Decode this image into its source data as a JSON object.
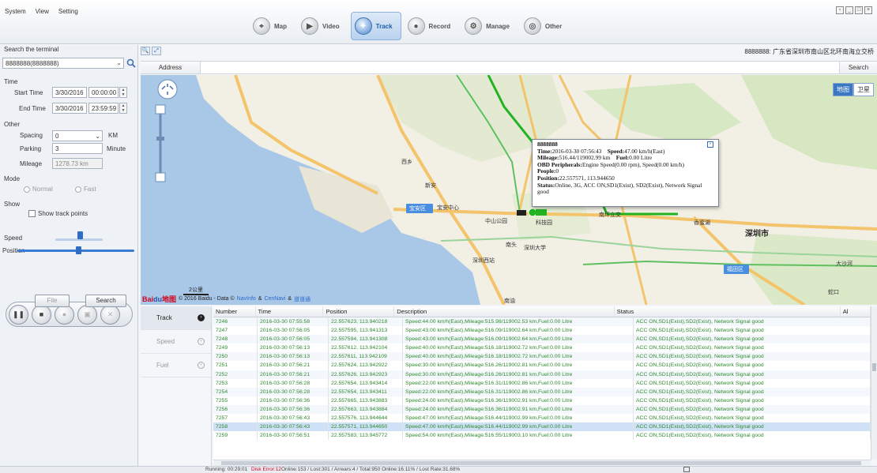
{
  "menu": [
    "System",
    "View",
    "Setting"
  ],
  "nav": [
    {
      "label": "Map",
      "icon": "map-icon",
      "active": false
    },
    {
      "label": "Video",
      "icon": "video-icon",
      "active": false
    },
    {
      "label": "Track",
      "icon": "track-icon",
      "active": true
    },
    {
      "label": "Record",
      "icon": "record-icon",
      "active": false
    },
    {
      "label": "Manage",
      "icon": "manage-icon",
      "active": false
    },
    {
      "label": "Other",
      "icon": "other-icon",
      "active": false
    }
  ],
  "left": {
    "search_title": "Search the terminal",
    "terminal_value": "8888888(8888888)",
    "time_title": "Time",
    "start_label": "Start Time",
    "start_date": "3/30/2016",
    "start_time": "00:00:00",
    "end_label": "End Time",
    "end_date": "3/30/2016",
    "end_time": "23:59:59",
    "other_title": "Other",
    "spacing_label": "Spacing",
    "spacing_value": "0",
    "spacing_unit": "KM",
    "parking_label": "Parking",
    "parking_value": "3",
    "parking_unit": "Minute",
    "mileage_label": "Mileage",
    "mileage_value": "1278.73 km",
    "mode_title": "Mode",
    "mode_normal": "Normal",
    "mode_fast": "Fast",
    "show_title": "Show",
    "show_track_points": "Show track points",
    "speed_label": "Speed",
    "position_label": "Position",
    "file_button": "File",
    "search_button": "Search"
  },
  "map": {
    "location_text": "8888888: 广东省深圳市南山区北环南海立交桥",
    "address_label": "Address",
    "search_label": "Search",
    "type_map": "地图",
    "type_satellite": "卫星",
    "scale": "2公里",
    "copyright": "© 2016 Baidu - Data ©",
    "navinfo": "NavInfo",
    "and1": "&",
    "cennavi": "CenNavi",
    "and2": "&",
    "daodaotong": "道道通",
    "logo_bai": "Bai",
    "logo_du": "du",
    "logo_cn": "地图"
  },
  "popup": {
    "title": "8888888",
    "time_label": "Time:",
    "time_value": "2016-03-30 07:56:43",
    "speed_label": "Speed:",
    "speed_value": "47.00 km/h(East)",
    "mileage_label": "Mileage:",
    "mileage_value": "516.44/119002.99 km",
    "fuel_label": "Fuel:",
    "fuel_value": "0.00 Litre",
    "obd_label": "OBD Peripherals:",
    "obd_value": "Engine Speed(0.00 rpm), Speed(0.00 km/h)",
    "people_label": "People:",
    "people_value": "0",
    "position_label": "Position:",
    "position_value": "22.557571, 113.944650",
    "status_label": "Status:",
    "status_value": "Online, 3G, ACC ON,SD1(Exist), SD2(Exist), Network Signal good"
  },
  "bottom_tabs": [
    "Track",
    "Speed",
    "Fuel"
  ],
  "table": {
    "headers": [
      "Number",
      "Time",
      "Position",
      "Description",
      "Status",
      "Al"
    ],
    "rows": [
      [
        "7246",
        "2016-03-30 07:55:58",
        "22.557623, 113.940218",
        "Speed:44.00 km/h(East),Mileage:515.98/119002.53 km,Fuel:0.00 Litre",
        "ACC ON,SD1(Exist),SD2(Exist), Network Signal good"
      ],
      [
        "7247",
        "2016-03-30 07:56:05",
        "22.557595, 113.941313",
        "Speed:43.00 km/h(East),Mileage:516.09/119002.64 km,Fuel:0.00 Litre",
        "ACC ON,SD1(Exist),SD2(Exist), Network Signal good"
      ],
      [
        "7248",
        "2016-03-30 07:56:05",
        "22.557594, 113.941308",
        "Speed:43.00 km/h(East),Mileage:516.09/119002.64 km,Fuel:0.00 Litre",
        "ACC ON,SD1(Exist),SD2(Exist), Network Signal good"
      ],
      [
        "7249",
        "2016-03-30 07:56:13",
        "22.557612, 113.942104",
        "Speed:40.00 km/h(East),Mileage:516.18/119002.72 km,Fuel:0.00 Litre",
        "ACC ON,SD1(Exist),SD2(Exist), Network Signal good"
      ],
      [
        "7250",
        "2016-03-30 07:56:13",
        "22.557611, 113.942109",
        "Speed:40.00 km/h(East),Mileage:516.18/119002.72 km,Fuel:0.00 Litre",
        "ACC ON,SD1(Exist),SD2(Exist), Network Signal good"
      ],
      [
        "7251",
        "2016-03-30 07:56:21",
        "22.557624, 113.942922",
        "Speed:30.00 km/h(East),Mileage:516.26/119002.81 km,Fuel:0.00 Litre",
        "ACC ON,SD1(Exist),SD2(Exist), Network Signal good"
      ],
      [
        "7252",
        "2016-03-30 07:56:21",
        "22.557626, 113.942923",
        "Speed:30.00 km/h(East),Mileage:516.26/119002.81 km,Fuel:0.00 Litre",
        "ACC ON,SD1(Exist),SD2(Exist), Network Signal good"
      ],
      [
        "7253",
        "2016-03-30 07:56:28",
        "22.557654, 113.943414",
        "Speed:22.00 km/h(East),Mileage:516.31/119002.86 km,Fuel:0.00 Litre",
        "ACC ON,SD1(Exist),SD2(Exist), Network Signal good"
      ],
      [
        "7254",
        "2016-03-30 07:56:28",
        "22.557654, 113.943411",
        "Speed:22.00 km/h(East),Mileage:516.31/119002.86 km,Fuel:0.00 Litre",
        "ACC ON,SD1(Exist),SD2(Exist), Network Signal good"
      ],
      [
        "7255",
        "2016-03-30 07:56:36",
        "22.557665, 113.943883",
        "Speed:24.00 km/h(East),Mileage:516.36/119002.91 km,Fuel:0.00 Litre",
        "ACC ON,SD1(Exist),SD2(Exist), Network Signal good"
      ],
      [
        "7256",
        "2016-03-30 07:56:36",
        "22.557663, 113.943884",
        "Speed:24.00 km/h(East),Mileage:516.36/119002.91 km,Fuel:0.00 Litre",
        "ACC ON,SD1(Exist),SD2(Exist), Network Signal good"
      ],
      [
        "7257",
        "2016-03-30 07:56:43",
        "22.557576, 113.944644",
        "Speed:47.00 km/h(East),Mileage:516.44/119002.99 km,Fuel:0.00 Litre",
        "ACC ON,SD1(Exist),SD2(Exist), Network Signal good"
      ],
      [
        "7258",
        "2016-03-30 07:56:43",
        "22.557571, 113.944650",
        "Speed:47.00 km/h(East),Mileage:516.44/119002.99 km,Fuel:0.00 Litre",
        "ACC ON,SD1(Exist),SD2(Exist), Network Signal good"
      ],
      [
        "7259",
        "2016-03-30 07:56:51",
        "22.557583, 113.945772",
        "Speed:54.00 km/h(East),Mileage:516.55/119003.10 km,Fuel:0.00 Litre",
        "ACC ON,SD1(Exist),SD2(Exist), Network Signal good"
      ]
    ],
    "selected_row": 12
  },
  "status_bar": {
    "running": "Running: 00:29:01",
    "disk": "Disk Error:12",
    "counts": "Online:153 / Lost:301 / Arrears:4 / Total:950   Online:16.11% / Lost Rate:31.68%"
  },
  "map_labels": {
    "l1": "宝安区",
    "l2": "福田区",
    "l3": "深圳市",
    "l4": "科技园",
    "l5": "南头",
    "l6": "深圳大学",
    "l7": "深圳西站",
    "l8": "中山公园",
    "l9": "西乡",
    "l10": "宝安中心",
    "l11": "新安",
    "l12": "南坪立交",
    "l13": "香蜜湖",
    "l14": "大沙河",
    "l15": "蛇口",
    "l16": "南油"
  },
  "colors": {
    "accent": "#3a7bd5",
    "track": "#22b322",
    "selected_row": "#cfe1f7"
  }
}
